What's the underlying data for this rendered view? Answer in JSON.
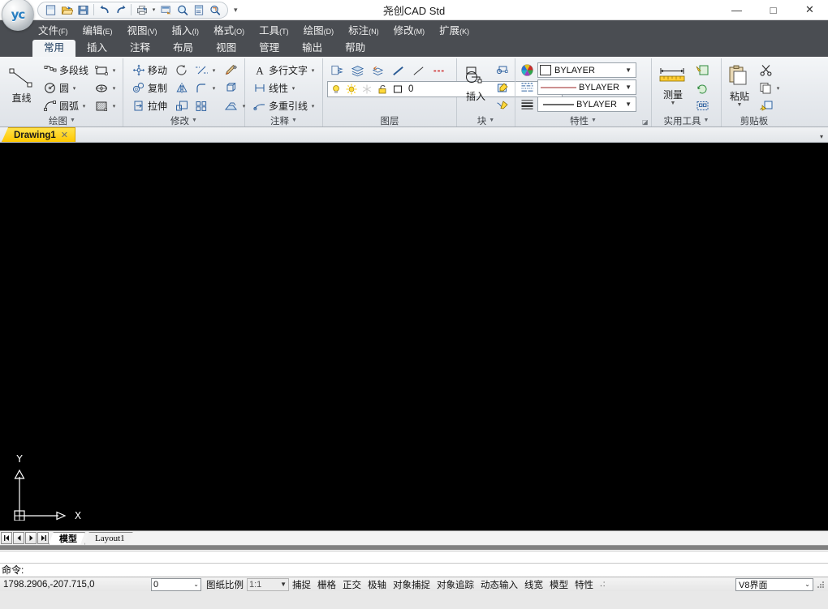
{
  "window": {
    "title": "尧创CAD Std",
    "minimize_label": "—",
    "maximize_label": "□",
    "close_label": "✕",
    "logo_text": "yc"
  },
  "quick_access": {
    "items": [
      {
        "name": "new-icon",
        "tooltip": "新建"
      },
      {
        "name": "open-icon",
        "tooltip": "打开"
      },
      {
        "name": "save-icon",
        "tooltip": "保存"
      },
      {
        "name": "undo-icon",
        "tooltip": "放弃"
      },
      {
        "name": "redo-icon",
        "tooltip": "重做"
      },
      {
        "name": "print-icon",
        "tooltip": "打印"
      },
      {
        "name": "plot-preview-icon",
        "tooltip": "打印预览"
      },
      {
        "name": "zoom-icon",
        "tooltip": "缩放"
      },
      {
        "name": "sheet-set-icon",
        "tooltip": "图纸集"
      },
      {
        "name": "zoom-window-icon",
        "tooltip": "窗口缩放"
      }
    ],
    "more_label": "▾"
  },
  "menubar": {
    "items": [
      {
        "label": "文件",
        "key": "F"
      },
      {
        "label": "编辑",
        "key": "E"
      },
      {
        "label": "视图",
        "key": "V"
      },
      {
        "label": "插入",
        "key": "I"
      },
      {
        "label": "格式",
        "key": "O"
      },
      {
        "label": "工具",
        "key": "T"
      },
      {
        "label": "绘图",
        "key": "D"
      },
      {
        "label": "标注",
        "key": "N"
      },
      {
        "label": "修改",
        "key": "M"
      },
      {
        "label": "扩展",
        "key": "K"
      }
    ]
  },
  "ribbon": {
    "tabs": [
      {
        "label": "常用",
        "active": true
      },
      {
        "label": "插入",
        "active": false
      },
      {
        "label": "注释",
        "active": false
      },
      {
        "label": "布局",
        "active": false
      },
      {
        "label": "视图",
        "active": false
      },
      {
        "label": "管理",
        "active": false
      },
      {
        "label": "输出",
        "active": false
      },
      {
        "label": "帮助",
        "active": false
      }
    ],
    "panels": {
      "draw": {
        "title": "绘图",
        "big_button": "直线",
        "items": [
          {
            "label": "多段线",
            "icon": "polyline-icon"
          },
          {
            "label": "圆",
            "icon": "circle-icon"
          },
          {
            "label": "圆弧",
            "icon": "arc-icon"
          }
        ],
        "icon_items": [
          {
            "icon": "rectangle-icon"
          },
          {
            "icon": "ellipse-icon"
          },
          {
            "icon": "hatch-icon"
          }
        ]
      },
      "modify": {
        "title": "修改",
        "items": [
          {
            "label": "移动",
            "icon": "move-icon"
          },
          {
            "label": "复制",
            "icon": "copy-icon"
          },
          {
            "label": "拉伸",
            "icon": "stretch-icon"
          }
        ],
        "icon_items": [
          {
            "icon": "rotate-icon"
          },
          {
            "icon": "trim-icon"
          },
          {
            "icon": "erase-icon"
          },
          {
            "icon": "mirror-icon"
          },
          {
            "icon": "fillet-icon"
          },
          {
            "icon": "3drotate-icon"
          },
          {
            "icon": "scale-icon"
          },
          {
            "icon": "array-icon"
          },
          {
            "icon": "chamfer-icon"
          }
        ]
      },
      "annotation": {
        "title": "注释",
        "items": [
          {
            "label": "多行文字",
            "icon": "mtext-icon"
          },
          {
            "label": "线性",
            "icon": "linear-dimension-icon"
          },
          {
            "label": "多重引线",
            "icon": "multileader-icon"
          }
        ]
      },
      "layers": {
        "title": "图层",
        "tools": [
          {
            "icon": "layer-properties-icon"
          },
          {
            "icon": "layer-manager-icon"
          },
          {
            "icon": "layer-previous-icon"
          },
          {
            "icon": "layer-line1-icon"
          },
          {
            "icon": "layer-line2-icon"
          },
          {
            "icon": "layer-dashed-icon"
          }
        ],
        "current_layer": "0",
        "state_icons": [
          {
            "icon": "lightbulb-icon"
          },
          {
            "icon": "sun-icon"
          },
          {
            "icon": "freeze-icon"
          },
          {
            "icon": "unlock-icon"
          },
          {
            "icon": "layer-color-icon"
          }
        ]
      },
      "block": {
        "title": "块",
        "big_button": "插入",
        "icon_items": [
          {
            "icon": "create-block-icon"
          },
          {
            "icon": "edit-attribute-icon"
          },
          {
            "icon": "define-attribute-icon"
          }
        ]
      },
      "properties": {
        "title": "特性",
        "rows": [
          {
            "icon": "color-wheel-icon",
            "value": "BYLAYER",
            "type": "color"
          },
          {
            "icon": "linetype-icon",
            "value": "BYLAYER",
            "type": "linetype"
          },
          {
            "icon": "lineweight-icon",
            "value": "BYLAYER",
            "type": "lineweight"
          }
        ]
      },
      "utilities": {
        "title": "实用工具",
        "big_button": "测量",
        "icon_items": [
          {
            "icon": "quick-select-icon"
          },
          {
            "icon": "quick-calc-icon"
          },
          {
            "icon": "select-all-icon"
          }
        ]
      },
      "clipboard": {
        "title": "剪贴板",
        "big_button": "粘贴",
        "icon_items": [
          {
            "icon": "cut-icon"
          },
          {
            "icon": "copy-clip-icon"
          },
          {
            "icon": "paste-special-icon"
          }
        ]
      }
    }
  },
  "document_tabs": {
    "tabs": [
      {
        "label": "Drawing1",
        "close": "✕",
        "active": true
      }
    ],
    "overflow_caret": "▾"
  },
  "canvas": {
    "background": "#000000",
    "ucs": {
      "x_label": "X",
      "y_label": "Y"
    }
  },
  "model_tabs": {
    "nav": [
      "|◀",
      "◀",
      "▶",
      "▶|"
    ],
    "tabs": [
      {
        "label": "模型",
        "active": true
      },
      {
        "label": "Layout1",
        "active": false
      }
    ]
  },
  "command_line": {
    "history": "",
    "prompt": "命令:"
  },
  "status_bar": {
    "coordinates": "1798.2906,-207.715,0",
    "layer_select": "0",
    "scale_label": "图纸比例",
    "scale_value": "1:1",
    "toggles": [
      {
        "label": "捕捉",
        "on": false
      },
      {
        "label": "栅格",
        "on": false
      },
      {
        "label": "正交",
        "on": false
      },
      {
        "label": "极轴",
        "on": false
      },
      {
        "label": "对象捕捉",
        "on": false
      },
      {
        "label": "对象追踪",
        "on": false
      },
      {
        "label": "动态输入",
        "on": false
      },
      {
        "label": "线宽",
        "on": false
      },
      {
        "label": "模型",
        "on": false
      },
      {
        "label": "特性",
        "on": false
      }
    ],
    "dots": ".:",
    "ui_mode": "V8界面"
  },
  "colors": {
    "accent": "#ffc800",
    "menubar_bg": "#4a4d52",
    "ribbon_bg": "#e7eaee",
    "canvas_bg": "#000000"
  }
}
